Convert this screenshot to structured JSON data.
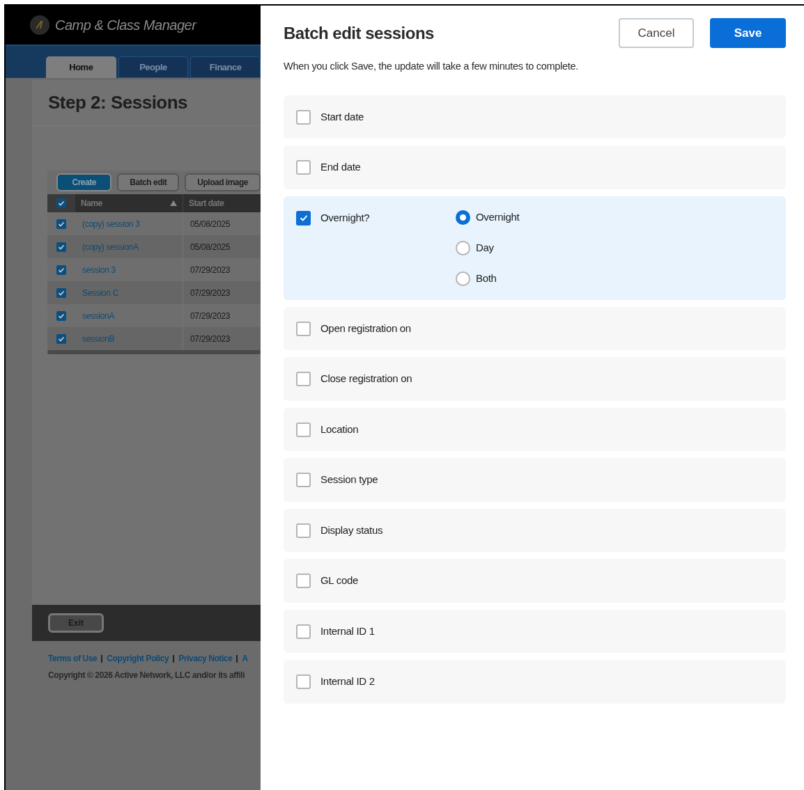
{
  "background_app": {
    "app_title": "Camp & Class Manager",
    "nav_tabs": [
      {
        "label": "Home",
        "selected": true
      },
      {
        "label": "People",
        "selected": false
      },
      {
        "label": "Finance",
        "selected": false
      }
    ],
    "page_title": "Step 2: Sessions",
    "toolbar_buttons": [
      {
        "label": "Create",
        "kind": "primary"
      },
      {
        "label": "Batch edit",
        "kind": "secondary"
      },
      {
        "label": "Upload image",
        "kind": "secondary"
      }
    ],
    "table": {
      "all_checked": true,
      "columns": [
        "Name",
        "Start date"
      ],
      "rows": [
        {
          "checked": true,
          "name": "(copy) session 3",
          "start_date": "05/08/2025"
        },
        {
          "checked": true,
          "name": "(copy) sessionA",
          "start_date": "05/08/2025"
        },
        {
          "checked": true,
          "name": "session 3",
          "start_date": "07/29/2023"
        },
        {
          "checked": true,
          "name": "Session C",
          "start_date": "07/29/2023"
        },
        {
          "checked": true,
          "name": "sessionA",
          "start_date": "07/29/2023"
        },
        {
          "checked": true,
          "name": "sessionB",
          "start_date": "07/29/2023"
        }
      ]
    },
    "exit_button": "Exit",
    "footer_links": [
      "Terms of Use",
      "Copyright Policy",
      "Privacy Notice",
      "A"
    ],
    "copyright": "Copyright © 2026 Active Network, LLC and/or its affili"
  },
  "drawer": {
    "title": "Batch edit sessions",
    "cancel": "Cancel",
    "save": "Save",
    "description": "When you click Save, the update will take a few minutes to complete.",
    "fields": [
      {
        "label": "Start date",
        "checked": false
      },
      {
        "label": "End date",
        "checked": false
      },
      {
        "label": "Overnight?",
        "checked": true,
        "options": [
          {
            "label": "Overnight",
            "selected": true
          },
          {
            "label": "Day",
            "selected": false
          },
          {
            "label": "Both",
            "selected": false
          }
        ]
      },
      {
        "label": "Open registration on",
        "checked": false
      },
      {
        "label": "Close registration on",
        "checked": false
      },
      {
        "label": "Location",
        "checked": false
      },
      {
        "label": "Session type",
        "checked": false
      },
      {
        "label": "Display status",
        "checked": false
      },
      {
        "label": "GL code",
        "checked": false
      },
      {
        "label": "Internal ID 1",
        "checked": false
      },
      {
        "label": "Internal ID 2",
        "checked": false
      }
    ]
  }
}
